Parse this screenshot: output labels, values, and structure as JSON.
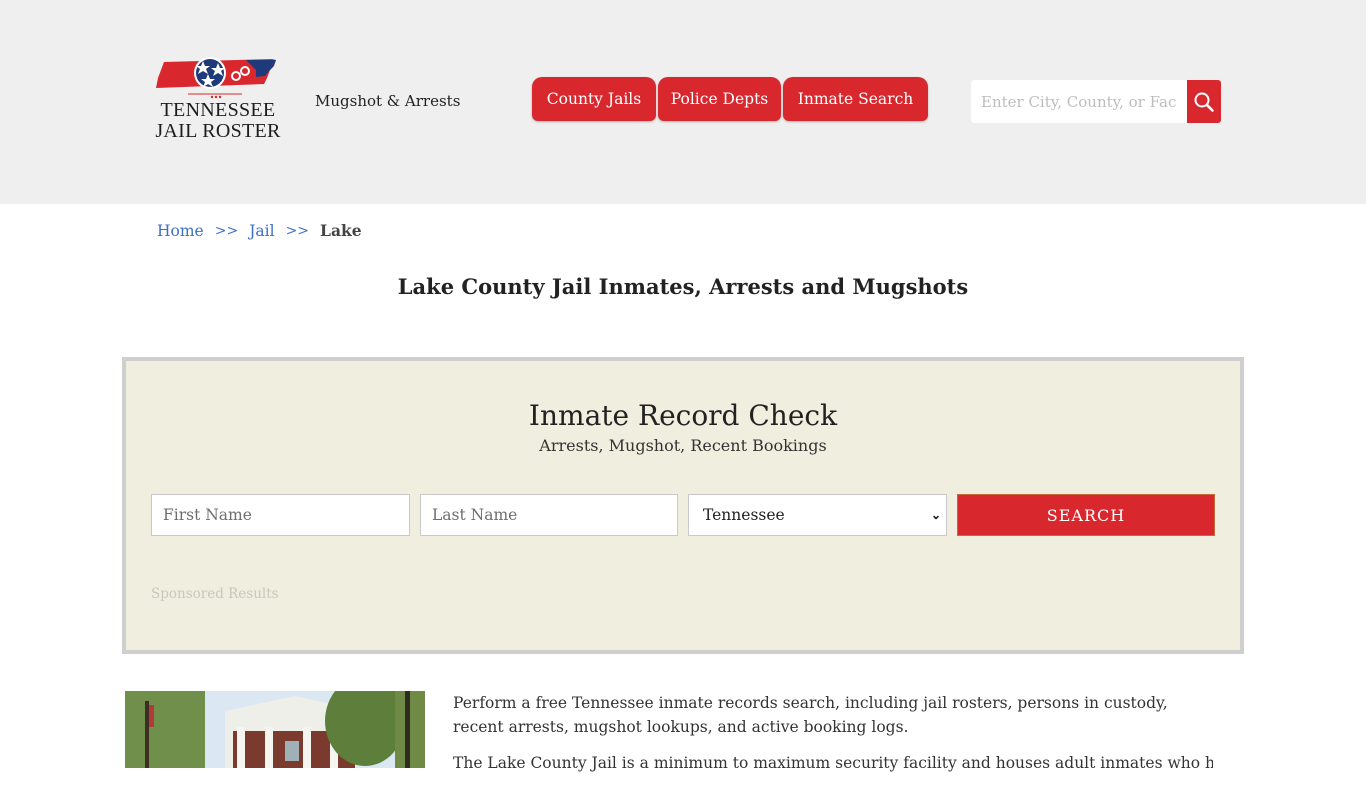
{
  "header": {
    "logo": {
      "line1": "TENNESSEE",
      "line2": "JAIL ROSTER",
      "colors": {
        "red": "#d9272e",
        "navy": "#1f3a7a"
      }
    },
    "tagline": "Mugshot & Arrests",
    "nav": [
      {
        "label": "County Jails"
      },
      {
        "label": "Police Depts"
      },
      {
        "label": "Inmate Search"
      }
    ],
    "search": {
      "placeholder": "Enter City, County, or Facility",
      "icon": "search-icon"
    }
  },
  "breadcrumb": {
    "items": [
      {
        "label": "Home"
      },
      {
        "label": "Jail"
      },
      {
        "label": "Lake"
      }
    ],
    "separator": ">>"
  },
  "page_title": "Lake County Jail Inmates, Arrests and Mugshots",
  "record_check": {
    "title": "Inmate Record Check",
    "subtitle": "Arrests, Mugshot, Recent Bookings",
    "first_name_placeholder": "First Name",
    "last_name_placeholder": "Last Name",
    "state_selected": "Tennessee",
    "search_label": "SEARCH",
    "sponsored": "Sponsored Results"
  },
  "content": {
    "photo_alt": "Lake County Jail building",
    "paragraphs": [
      "Perform a free Tennessee inmate records search, including jail rosters, persons in custody, recent arrests, mugshot lookups, and active booking logs.",
      "The Lake County Jail is a minimum to maximum security facility and houses adult inmates who h"
    ]
  },
  "colors": {
    "accent": "#d9272e",
    "link": "#3d6fc7",
    "panel_bg": "#f0eedf",
    "header_bg": "#efefef"
  }
}
